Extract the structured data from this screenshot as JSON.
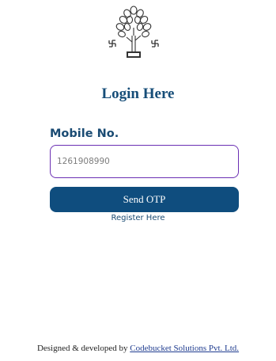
{
  "page": {
    "title": "Login Here"
  },
  "form": {
    "mobile_label": "Mobile No.",
    "mobile_value": "1261908990",
    "send_otp_label": "Send OTP",
    "register_link": "Register Here"
  },
  "footer": {
    "prefix": "Designed & developed by",
    "company_link": "Codebucket Solutions Pvt. Ltd."
  },
  "logo": {
    "icon": "bodhi-tree-emblem-icon"
  },
  "colors": {
    "primary": "#0f4d7e",
    "input_border": "#6b2fb3",
    "link": "#1f3c8f"
  }
}
